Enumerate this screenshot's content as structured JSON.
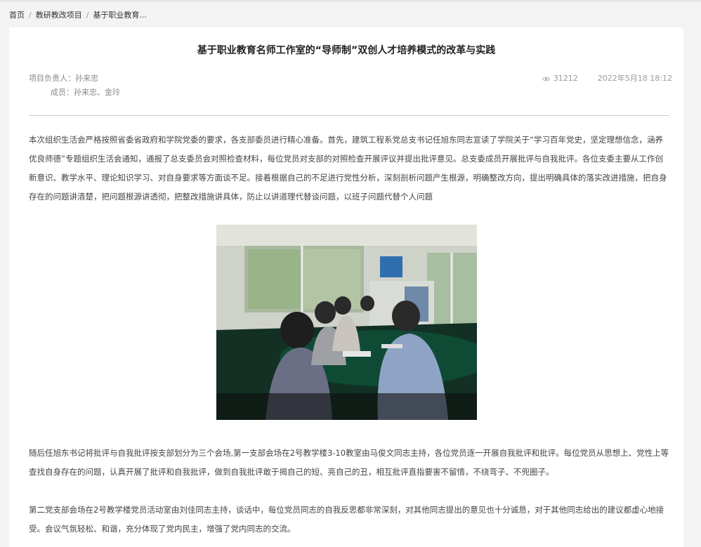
{
  "breadcrumb": {
    "home": "首页",
    "section": "教研教改项目",
    "current": "基于职业教育..."
  },
  "article": {
    "title": "基于职业教育名师工作室的“导师制”双创人才培养模式的改革与实践",
    "leader_label": "项目负责人：",
    "leader_name": "孙来忠",
    "members_label": "成员：",
    "members": "孙来忠、金玲",
    "views": "31212",
    "date": "2022年5月18 18:12",
    "paragraph1": "本次组织生活会严格按照省委省政府和学院党委的要求，各支部委员进行精心准备。首先，建筑工程系党总支书记任旭东同志宣读了学院关于“学习百年党史，坚定理想信念，涵养优良师德”专题组织生活会通知，通报了总支委员会对照检查材料，每位党员对支部的对照检查开展评议并提出批评意见。总支委成员开展批评与自我批评。各位支委主要从工作创新意识、教学水平、理论知识学习、对自身要求等方面谈不足。接着根据自己的不足进行党性分析，深刻剖析问题产生根源，明确整改方向，提出明确具体的落实改进措施，把自身存在的问题讲清楚，把问题根源讲透彻，把整改措施讲具体，防止以讲道理代替谈问题，以班子问题代替个人问题",
    "paragraph2": "随后任旭东书记将批评与自我批评按支部划分为三个会场,第一支部会场在2号教学楼3-10教室由马俊文同志主持，各位党员逐一开展自我批评和批评。每位党员从思想上、党性上等查找自身存在的问题，认真开展了批评和自我批评，做到自我批评敢于揭自己的短、亮自己的丑，相互批评直指要害不留情，不绕弯子、不兜圈子。",
    "paragraph3": "第二党支部会场在2号教学楼党员活动室由刘佳同志主持，谈话中，每位党员同志的自我反思都非常深刻，对其他同志提出的意见也十分诚恳，对于其他同志给出的建议都虚心地接受。会议气氛轻松、和谐，充分体现了党内民主，增强了党内同志的交流。"
  },
  "icons": {
    "views": "eye-icon"
  },
  "colors": {
    "background": "#f3f3f3",
    "card": "#ffffff",
    "divider": "#cccccc"
  }
}
